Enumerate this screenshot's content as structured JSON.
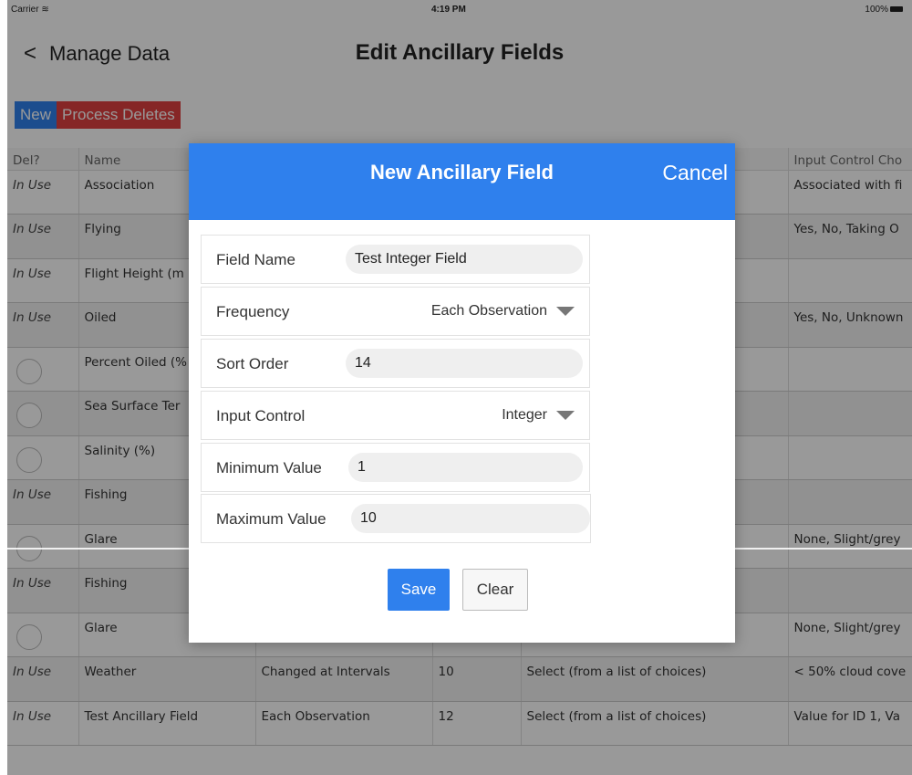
{
  "status_bar": {
    "carrier": "Carrier",
    "wifi_icon": "wifi-icon",
    "time": "4:19 PM",
    "battery": "100%",
    "battery_icon": "battery-icon"
  },
  "nav": {
    "back_icon": "chevron-left-icon",
    "back_label": "Manage Data",
    "title": "Edit Ancillary Fields"
  },
  "toolbar": {
    "new_label": "New",
    "process_deletes_label": "Process Deletes",
    "new_color": "#2f80ed",
    "delete_color": "#e04040"
  },
  "table": {
    "headers": [
      "Del?",
      "Name",
      "",
      "",
      "",
      "Input Control Cho"
    ],
    "rows": [
      {
        "del": "In Use",
        "name": "Association",
        "freq": "",
        "sort": "",
        "input": "",
        "choices": "Associated with fi"
      },
      {
        "del": "In Use",
        "name": "Flying",
        "freq": "",
        "sort": "",
        "input": "",
        "choices": "Yes, No, Taking O"
      },
      {
        "del": "In Use",
        "name": "Flight Height (m",
        "freq": "",
        "sort": "",
        "input": "",
        "choices": ""
      },
      {
        "del": "In Use",
        "name": "Oiled",
        "freq": "",
        "sort": "",
        "input": "",
        "choices": "Yes, No, Unknown"
      },
      {
        "del": "",
        "name": "Percent Oiled (%",
        "freq": "",
        "sort": "",
        "input": "",
        "choices": ""
      },
      {
        "del": "",
        "name": "Sea Surface Ter",
        "freq": "",
        "sort": "",
        "input": "",
        "choices": ""
      },
      {
        "del": "",
        "name": "Salinity (%)",
        "freq": "",
        "sort": "",
        "input": "",
        "choices": ""
      },
      {
        "del": "In Use",
        "name": "Fishing",
        "freq": "",
        "sort": "",
        "input": "",
        "choices": ""
      },
      {
        "del": "",
        "name": "Glare",
        "freq": "",
        "sort": "",
        "input": "",
        "choices": "None, Slight/grey"
      },
      {
        "del": "In Use",
        "name": "Fishing",
        "freq": "",
        "sort": "",
        "input": "",
        "choices": ""
      },
      {
        "del": "",
        "name": "Glare",
        "freq": "",
        "sort": "",
        "input": "",
        "choices": "None, Slight/grey"
      },
      {
        "del": "In Use",
        "name": "Weather",
        "freq": "Changed at Intervals",
        "sort": "10",
        "input": "Select (from a list of choices)",
        "choices": "< 50% cloud cove"
      },
      {
        "del": "In Use",
        "name": "Test Ancillary Field",
        "freq": "Each Observation",
        "sort": "12",
        "input": "Select (from a list of choices)",
        "choices": "Value for ID 1, Va"
      }
    ]
  },
  "modal": {
    "title": "New Ancillary Field",
    "cancel_label": "Cancel",
    "header_color": "#2f80ed",
    "field_name": {
      "label": "Field Name",
      "value": "Test Integer Field"
    },
    "frequency": {
      "label": "Frequency",
      "value": "Each Observation",
      "icon": "caret-down-icon"
    },
    "sort_order": {
      "label": "Sort Order",
      "value": "14"
    },
    "input_control": {
      "label": "Input Control",
      "value": "Integer",
      "icon": "caret-down-icon"
    },
    "minimum_value": {
      "label": "Minimum Value",
      "value": "1"
    },
    "maximum_value": {
      "label": "Maximum Value",
      "value": "10"
    },
    "save_label": "Save",
    "clear_label": "Clear"
  }
}
